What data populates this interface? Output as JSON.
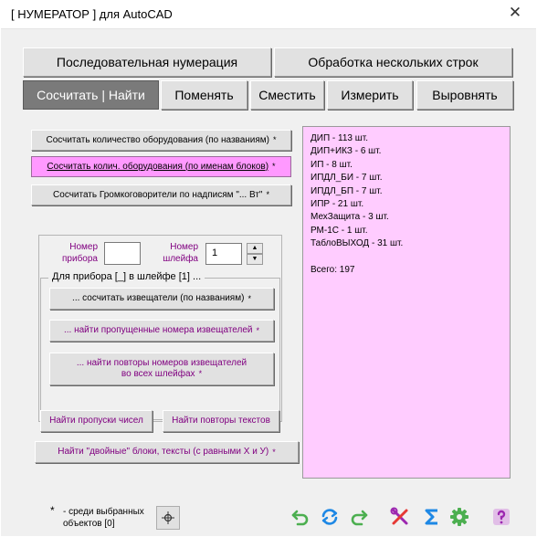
{
  "window": {
    "title": "[ НУМЕРАТОР ]  для AutoCAD",
    "close_glyph": "✕"
  },
  "main_tabs": {
    "sequential": "Последовательная нумерация",
    "multiline": "Обработка нескольких строк"
  },
  "sub_tabs": {
    "count_find": "Сосчитать | Найти",
    "replace": "Поменять",
    "shift": "Сместить",
    "measure": "Измерить",
    "align": "Выровнять"
  },
  "count_buttons": {
    "by_names": "Сосчитать количество оборудования (по названиям)",
    "by_blocks": "Сосчитать колич. оборудования (по именам блоков)",
    "speakers": "Сосчитать Громкоговорители по надписям \"... Вт\"",
    "marker": "*"
  },
  "device_panel": {
    "device_label_line1": "Номер",
    "device_label_line2": "прибора",
    "device_value": "",
    "loop_label_line1": "Номер",
    "loop_label_line2": "шлейфа",
    "loop_value": "1",
    "spin_up": "▲",
    "spin_down": "▼",
    "group_legend": "Для прибора [_]  в шлейфе  [1] ...",
    "count_detectors": "... сосчитать извещатели (по названиям)",
    "find_missing_line": "... найти пропущенные номера извещателей",
    "find_repeats_line1": "... найти повторы номеров извещателей",
    "find_repeats_line2": "во всех шлейфах",
    "marker": "*"
  },
  "bottom_buttons": {
    "find_gaps": "Найти пропуски чисел",
    "find_text_repeats": "Найти повторы текстов",
    "find_doubles": "Найти \"двойные\" блоки, тексты (с равными X и У)",
    "marker": "*"
  },
  "result": {
    "lines": [
      "ДИП - 113 шт.",
      "ДИП+ИКЗ - 6 шт.",
      "ИП - 8 шт.",
      "ИПДЛ_БИ - 7 шт.",
      "ИПДЛ_БП - 7 шт.",
      "ИПР - 21 шт.",
      "МехЗащита - 3 шт.",
      "РМ-1С - 1 шт.",
      "ТаблоВЫХОД - 31 шт.",
      "",
      "Всего: 197"
    ]
  },
  "footer": {
    "asterisk": "*",
    "note_line1": "- среди выбранных",
    "note_line2": "объектов  [0]",
    "icons": [
      "crosshair-icon",
      "undo-icon",
      "refresh-icon",
      "redo-icon",
      "tools-icon",
      "sigma-icon",
      "gear-icon",
      "help-icon"
    ],
    "colors": {
      "green": "#4caf50",
      "blue": "#1e88e5",
      "purple": "#9c27b0",
      "pink_panel": "#ffccff",
      "pink_button": "#ff99ff",
      "dark_tab": "#7a7a7a"
    }
  }
}
